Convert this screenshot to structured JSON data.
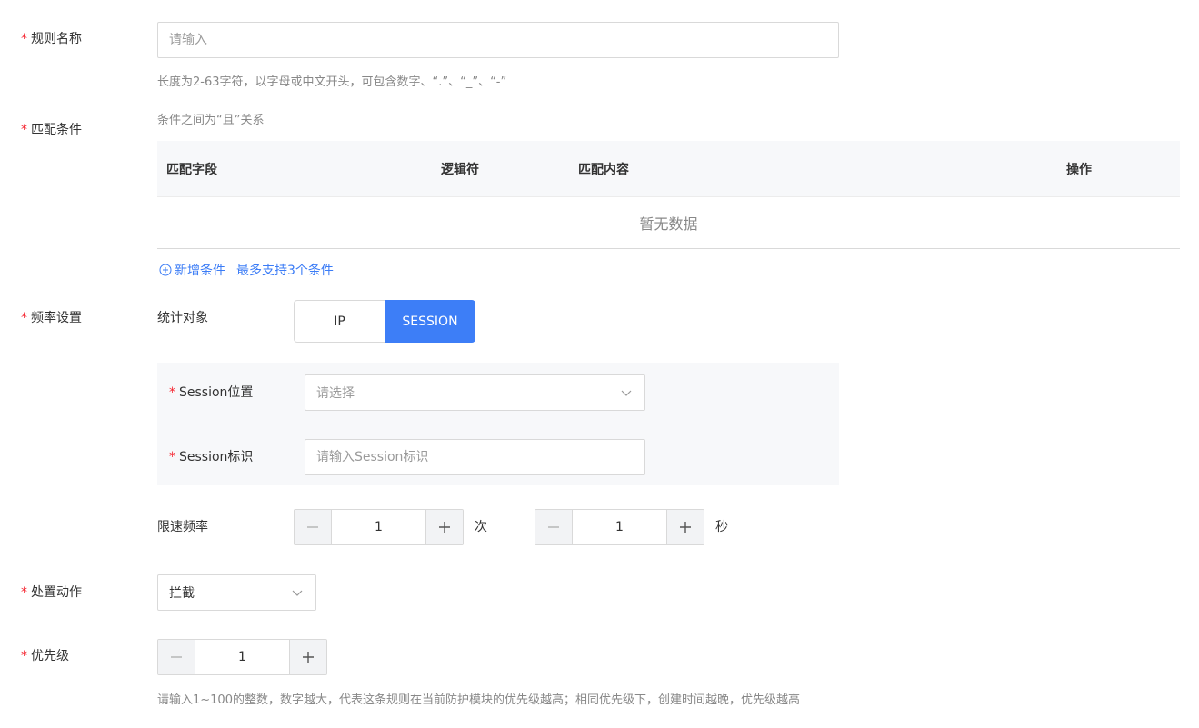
{
  "rule_name": {
    "label": "规则名称",
    "placeholder": "请输入",
    "hint": "长度为2-63字符，以字母或中文开头，可包含数字、“.”、“_”、“-”"
  },
  "match": {
    "label": "匹配条件",
    "hint": "条件之间为“且”关系",
    "columns": [
      "匹配字段",
      "逻辑符",
      "匹配内容",
      "操作"
    ],
    "empty_text": "暂无数据",
    "add_label": "新增条件",
    "limit_label": "最多支持3个条件"
  },
  "frequency": {
    "label": "频率设置",
    "target_label": "统计对象",
    "options": [
      "IP",
      "SESSION"
    ],
    "selected": "SESSION",
    "session_position": {
      "label": "Session位置",
      "placeholder": "请选择"
    },
    "session_id": {
      "label": "Session标识",
      "placeholder": "请输入Session标识"
    },
    "rate_label": "限速频率",
    "count_value": "1",
    "count_unit": "次",
    "period_value": "1",
    "period_unit": "秒"
  },
  "action": {
    "label": "处置动作",
    "value": "拦截"
  },
  "priority": {
    "label": "优先级",
    "value": "1",
    "hint": "请输入1~100的整数，数字越大，代表这条规则在当前防护模块的优先级越高；相同优先级下，创建时间越晚，优先级越高"
  },
  "colors": {
    "accent": "#3d7ef7",
    "required": "#f5222d"
  }
}
